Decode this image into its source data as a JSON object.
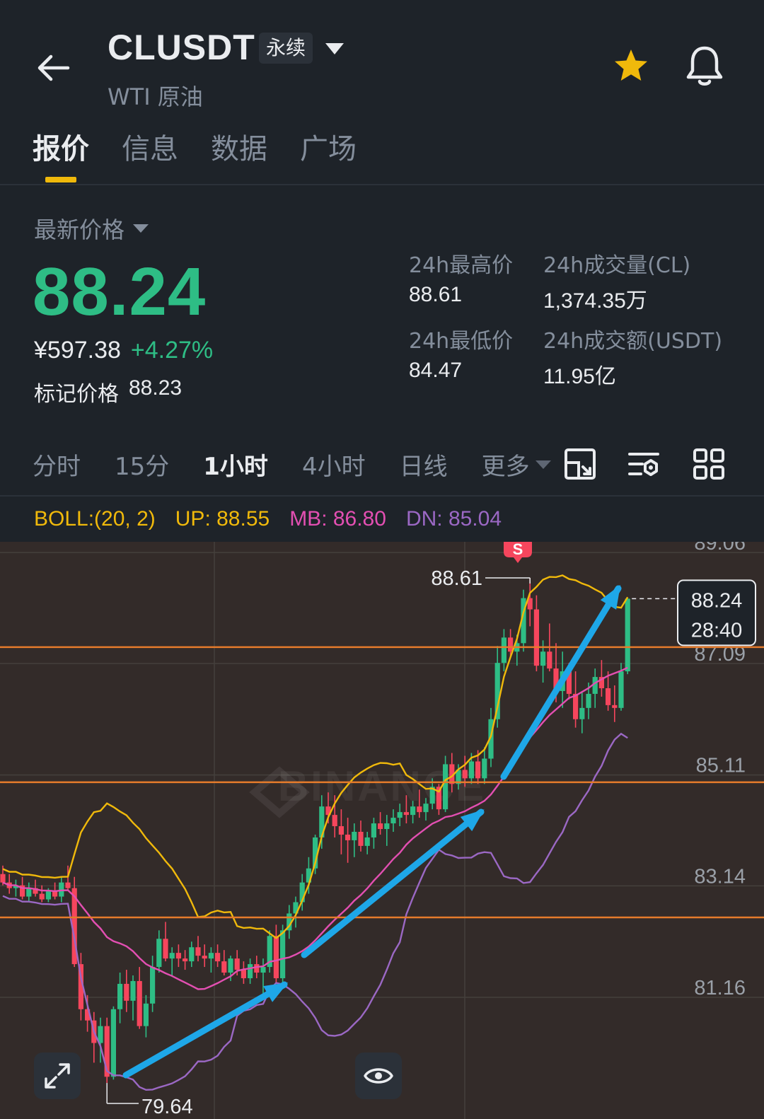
{
  "header": {
    "symbol": "CLUSDT",
    "badge": "永续",
    "subname": "WTI 原油",
    "back_icon": "arrow-left-icon",
    "favorite_icon": "star-icon",
    "alert_icon": "bell-icon"
  },
  "tabs": [
    {
      "label": "报价",
      "active": true
    },
    {
      "label": "信息",
      "active": false
    },
    {
      "label": "数据",
      "active": false
    },
    {
      "label": "广场",
      "active": false
    }
  ],
  "price": {
    "label": "最新价格",
    "last": "88.24",
    "cny": "¥597.38",
    "change": "+4.27%",
    "mark_label": "标记价格",
    "mark_value": "88.23"
  },
  "stats": {
    "high_label": "24h最高价",
    "high_value": "88.61",
    "low_label": "24h最低价",
    "low_value": "84.47",
    "vol_label": "24h成交量(CL)",
    "vol_value": "1,374.35万",
    "amount_label": "24h成交额(USDT)",
    "amount_value": "11.95亿"
  },
  "intervals": [
    "分时",
    "15分",
    "1小时",
    "4小时",
    "日线"
  ],
  "intervals_active": "1小时",
  "more_label": "更多",
  "tools": [
    "chart-expand-icon",
    "indicator-settings-icon",
    "grid-layout-icon"
  ],
  "boll": {
    "label": "BOLL:(20, 2)",
    "up": "UP: 88.55",
    "mb": "MB: 86.80",
    "dn": "DN: 85.04"
  },
  "colors": {
    "up": "#2ebd85",
    "down": "#f6465d",
    "boll_up": "#f0b90b",
    "boll_mb": "#e34fb2",
    "boll_dn": "#9b68c4",
    "level_line": "#e57b2b",
    "arrow": "#1ea7e8",
    "accent": "#f0b90b"
  },
  "chart_data": {
    "type": "candlestick",
    "y_ticks": [
      "89.06",
      "87.09",
      "85.11",
      "83.14",
      "81.16"
    ],
    "y_range": [
      79.0,
      89.25
    ],
    "high_marker": "88.61",
    "low_marker": "79.64",
    "sell_marker": "S",
    "current_price": "88.24",
    "countdown": "28:40",
    "horizontal_levels": [
      87.38,
      84.98,
      82.58
    ],
    "watermark": "BINANCE",
    "candles": [
      [
        83.35,
        83.5,
        83.15,
        83.2
      ],
      [
        83.2,
        83.35,
        83.0,
        83.1
      ],
      [
        83.1,
        83.25,
        82.95,
        83.15
      ],
      [
        83.15,
        83.3,
        82.9,
        82.95
      ],
      [
        82.95,
        83.2,
        82.85,
        83.1
      ],
      [
        83.1,
        83.25,
        82.95,
        83.0
      ],
      [
        83.0,
        83.15,
        82.85,
        82.9
      ],
      [
        82.9,
        83.1,
        82.85,
        83.05
      ],
      [
        83.05,
        83.2,
        82.9,
        82.95
      ],
      [
        82.95,
        83.3,
        82.85,
        83.2
      ],
      [
        83.2,
        83.5,
        83.05,
        83.1
      ],
      [
        83.1,
        83.3,
        81.7,
        81.75
      ],
      [
        81.75,
        81.95,
        80.75,
        80.95
      ],
      [
        80.95,
        81.2,
        80.55,
        80.75
      ],
      [
        80.75,
        80.9,
        80.0,
        80.35
      ],
      [
        80.35,
        80.8,
        80.0,
        80.65
      ],
      [
        80.65,
        80.8,
        79.64,
        79.75
      ],
      [
        79.75,
        81.0,
        79.7,
        80.95
      ],
      [
        80.95,
        81.6,
        80.7,
        81.4
      ],
      [
        81.4,
        81.65,
        80.9,
        81.1
      ],
      [
        81.1,
        81.55,
        80.75,
        81.45
      ],
      [
        81.45,
        81.7,
        80.6,
        80.65
      ],
      [
        80.65,
        81.2,
        80.45,
        81.05
      ],
      [
        81.05,
        81.9,
        80.9,
        81.7
      ],
      [
        81.7,
        82.35,
        81.6,
        82.2
      ],
      [
        82.2,
        82.5,
        81.8,
        81.85
      ],
      [
        81.85,
        82.05,
        81.55,
        81.95
      ],
      [
        81.95,
        82.1,
        81.7,
        81.85
      ],
      [
        81.85,
        82.0,
        81.65,
        81.8
      ],
      [
        81.8,
        82.15,
        81.7,
        82.05
      ],
      [
        82.05,
        82.25,
        81.8,
        81.9
      ],
      [
        81.9,
        82.1,
        81.7,
        81.85
      ],
      [
        81.85,
        82.05,
        81.6,
        81.95
      ],
      [
        81.95,
        82.1,
        81.7,
        81.8
      ],
      [
        81.8,
        82.0,
        81.55,
        81.6
      ],
      [
        81.6,
        81.9,
        81.45,
        81.85
      ],
      [
        81.85,
        82.0,
        81.55,
        81.65
      ],
      [
        81.65,
        81.8,
        81.4,
        81.5
      ],
      [
        81.5,
        81.85,
        81.4,
        81.75
      ],
      [
        81.75,
        81.9,
        81.5,
        81.6
      ],
      [
        81.6,
        81.85,
        81.2,
        81.7
      ],
      [
        81.7,
        82.35,
        81.6,
        82.25
      ],
      [
        82.25,
        82.45,
        81.4,
        81.5
      ],
      [
        81.5,
        82.45,
        81.35,
        82.35
      ],
      [
        82.35,
        82.8,
        82.2,
        82.65
      ],
      [
        82.65,
        82.95,
        82.4,
        82.85
      ],
      [
        82.85,
        83.35,
        82.7,
        83.2
      ],
      [
        83.2,
        83.65,
        83.0,
        83.45
      ],
      [
        83.45,
        84.05,
        83.35,
        84.0
      ],
      [
        84.0,
        84.75,
        83.8,
        84.55
      ],
      [
        84.55,
        84.8,
        84.25,
        84.4
      ],
      [
        84.4,
        84.75,
        84.0,
        84.2
      ],
      [
        84.2,
        84.5,
        83.7,
        84.05
      ],
      [
        84.05,
        84.35,
        83.55,
        83.95
      ],
      [
        83.95,
        84.25,
        83.65,
        84.1
      ],
      [
        84.1,
        84.3,
        83.75,
        83.85
      ],
      [
        83.85,
        84.1,
        83.7,
        84.0
      ],
      [
        84.0,
        84.35,
        83.8,
        84.25
      ],
      [
        84.25,
        84.45,
        84.05,
        84.15
      ],
      [
        84.15,
        84.4,
        83.85,
        84.25
      ],
      [
        84.25,
        84.5,
        84.1,
        84.35
      ],
      [
        84.35,
        84.6,
        84.2,
        84.45
      ],
      [
        84.45,
        84.75,
        84.25,
        84.4
      ],
      [
        84.4,
        84.65,
        84.25,
        84.55
      ],
      [
        84.55,
        84.85,
        84.35,
        84.45
      ],
      [
        84.45,
        84.7,
        84.3,
        84.6
      ],
      [
        84.6,
        85.05,
        84.5,
        84.9
      ],
      [
        84.9,
        84.95,
        84.4,
        84.5
      ],
      [
        84.5,
        85.45,
        84.45,
        85.3
      ],
      [
        85.3,
        85.5,
        84.8,
        84.95
      ],
      [
        84.95,
        85.3,
        84.85,
        85.2
      ],
      [
        85.2,
        85.45,
        84.9,
        85.05
      ],
      [
        85.05,
        85.5,
        84.95,
        85.35
      ],
      [
        85.35,
        85.55,
        84.95,
        85.05
      ],
      [
        85.05,
        85.6,
        84.95,
        85.4
      ],
      [
        85.4,
        86.3,
        85.25,
        86.1
      ],
      [
        86.1,
        87.4,
        85.95,
        87.1
      ],
      [
        87.1,
        87.7,
        86.95,
        87.55
      ],
      [
        87.55,
        87.7,
        87.2,
        87.3
      ],
      [
        87.3,
        87.6,
        87.05,
        87.45
      ],
      [
        87.45,
        88.4,
        87.3,
        88.25
      ],
      [
        88.25,
        88.61,
        87.75,
        88.05
      ],
      [
        88.05,
        88.3,
        86.95,
        87.05
      ],
      [
        87.05,
        87.5,
        86.75,
        87.3
      ],
      [
        87.3,
        87.8,
        86.95,
        87.0
      ],
      [
        87.0,
        87.45,
        86.4,
        86.6
      ],
      [
        86.6,
        87.3,
        86.3,
        86.95
      ],
      [
        86.95,
        87.1,
        86.45,
        86.55
      ],
      [
        86.55,
        86.95,
        85.95,
        86.1
      ],
      [
        86.1,
        86.6,
        85.85,
        86.3
      ],
      [
        86.3,
        86.75,
        86.1,
        86.55
      ],
      [
        86.55,
        87.0,
        86.3,
        86.85
      ],
      [
        86.85,
        87.15,
        86.5,
        86.65
      ],
      [
        86.65,
        86.95,
        86.25,
        86.35
      ],
      [
        86.35,
        86.7,
        86.05,
        86.3
      ],
      [
        86.3,
        87.1,
        86.25,
        86.95
      ],
      [
        86.95,
        88.25,
        86.9,
        88.24
      ]
    ]
  }
}
